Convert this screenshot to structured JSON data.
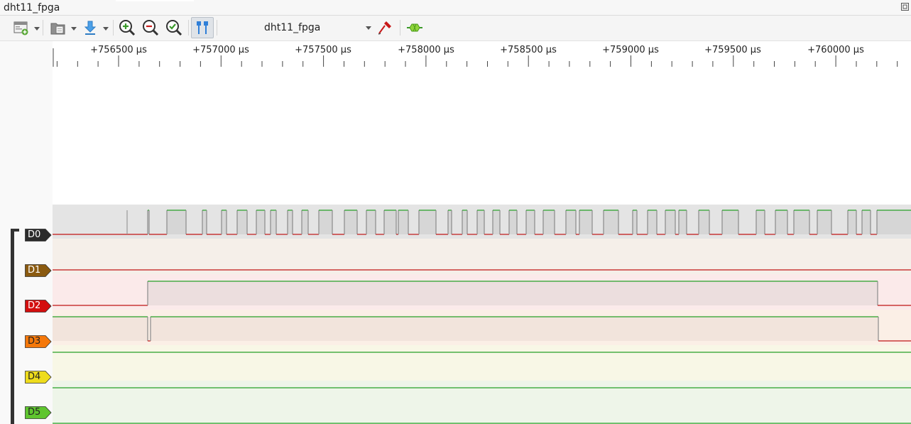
{
  "window": {
    "title": "dht11_fpga"
  },
  "toolbar": {
    "device_name": "dht11_fpga",
    "icons": [
      "new-view-icon",
      "open-file-icon",
      "download-icon",
      "zoom-in-icon",
      "zoom-out-icon",
      "zoom-fit-icon",
      "cursor-toggle-icon",
      "probe-icon",
      "decoder-icon"
    ]
  },
  "ruler": {
    "labels": [
      "+756500 µs",
      "+757000 µs",
      "+757500 µs",
      "+758000 µs",
      "+758500 µs",
      "+759000 µs",
      "+759500 µs",
      "+760000 µs"
    ]
  },
  "channels": [
    {
      "id": "D0",
      "label": "D0",
      "color": "#2b2b2b",
      "text": "#ffffff"
    },
    {
      "id": "D1",
      "label": "D1",
      "color": "#8a5a10",
      "text": "#ffffff"
    },
    {
      "id": "D2",
      "label": "D2",
      "color": "#d40f0f",
      "text": "#ffffff"
    },
    {
      "id": "D3",
      "label": "D3",
      "color": "#f5780a",
      "text": "#222222"
    },
    {
      "id": "D4",
      "label": "D4",
      "color": "#eedc1c",
      "text": "#222222"
    },
    {
      "id": "D5",
      "label": "D5",
      "color": "#5fc52f",
      "text": "#222222"
    }
  ],
  "colors": {
    "high": "#27a027",
    "low": "#c01515"
  }
}
